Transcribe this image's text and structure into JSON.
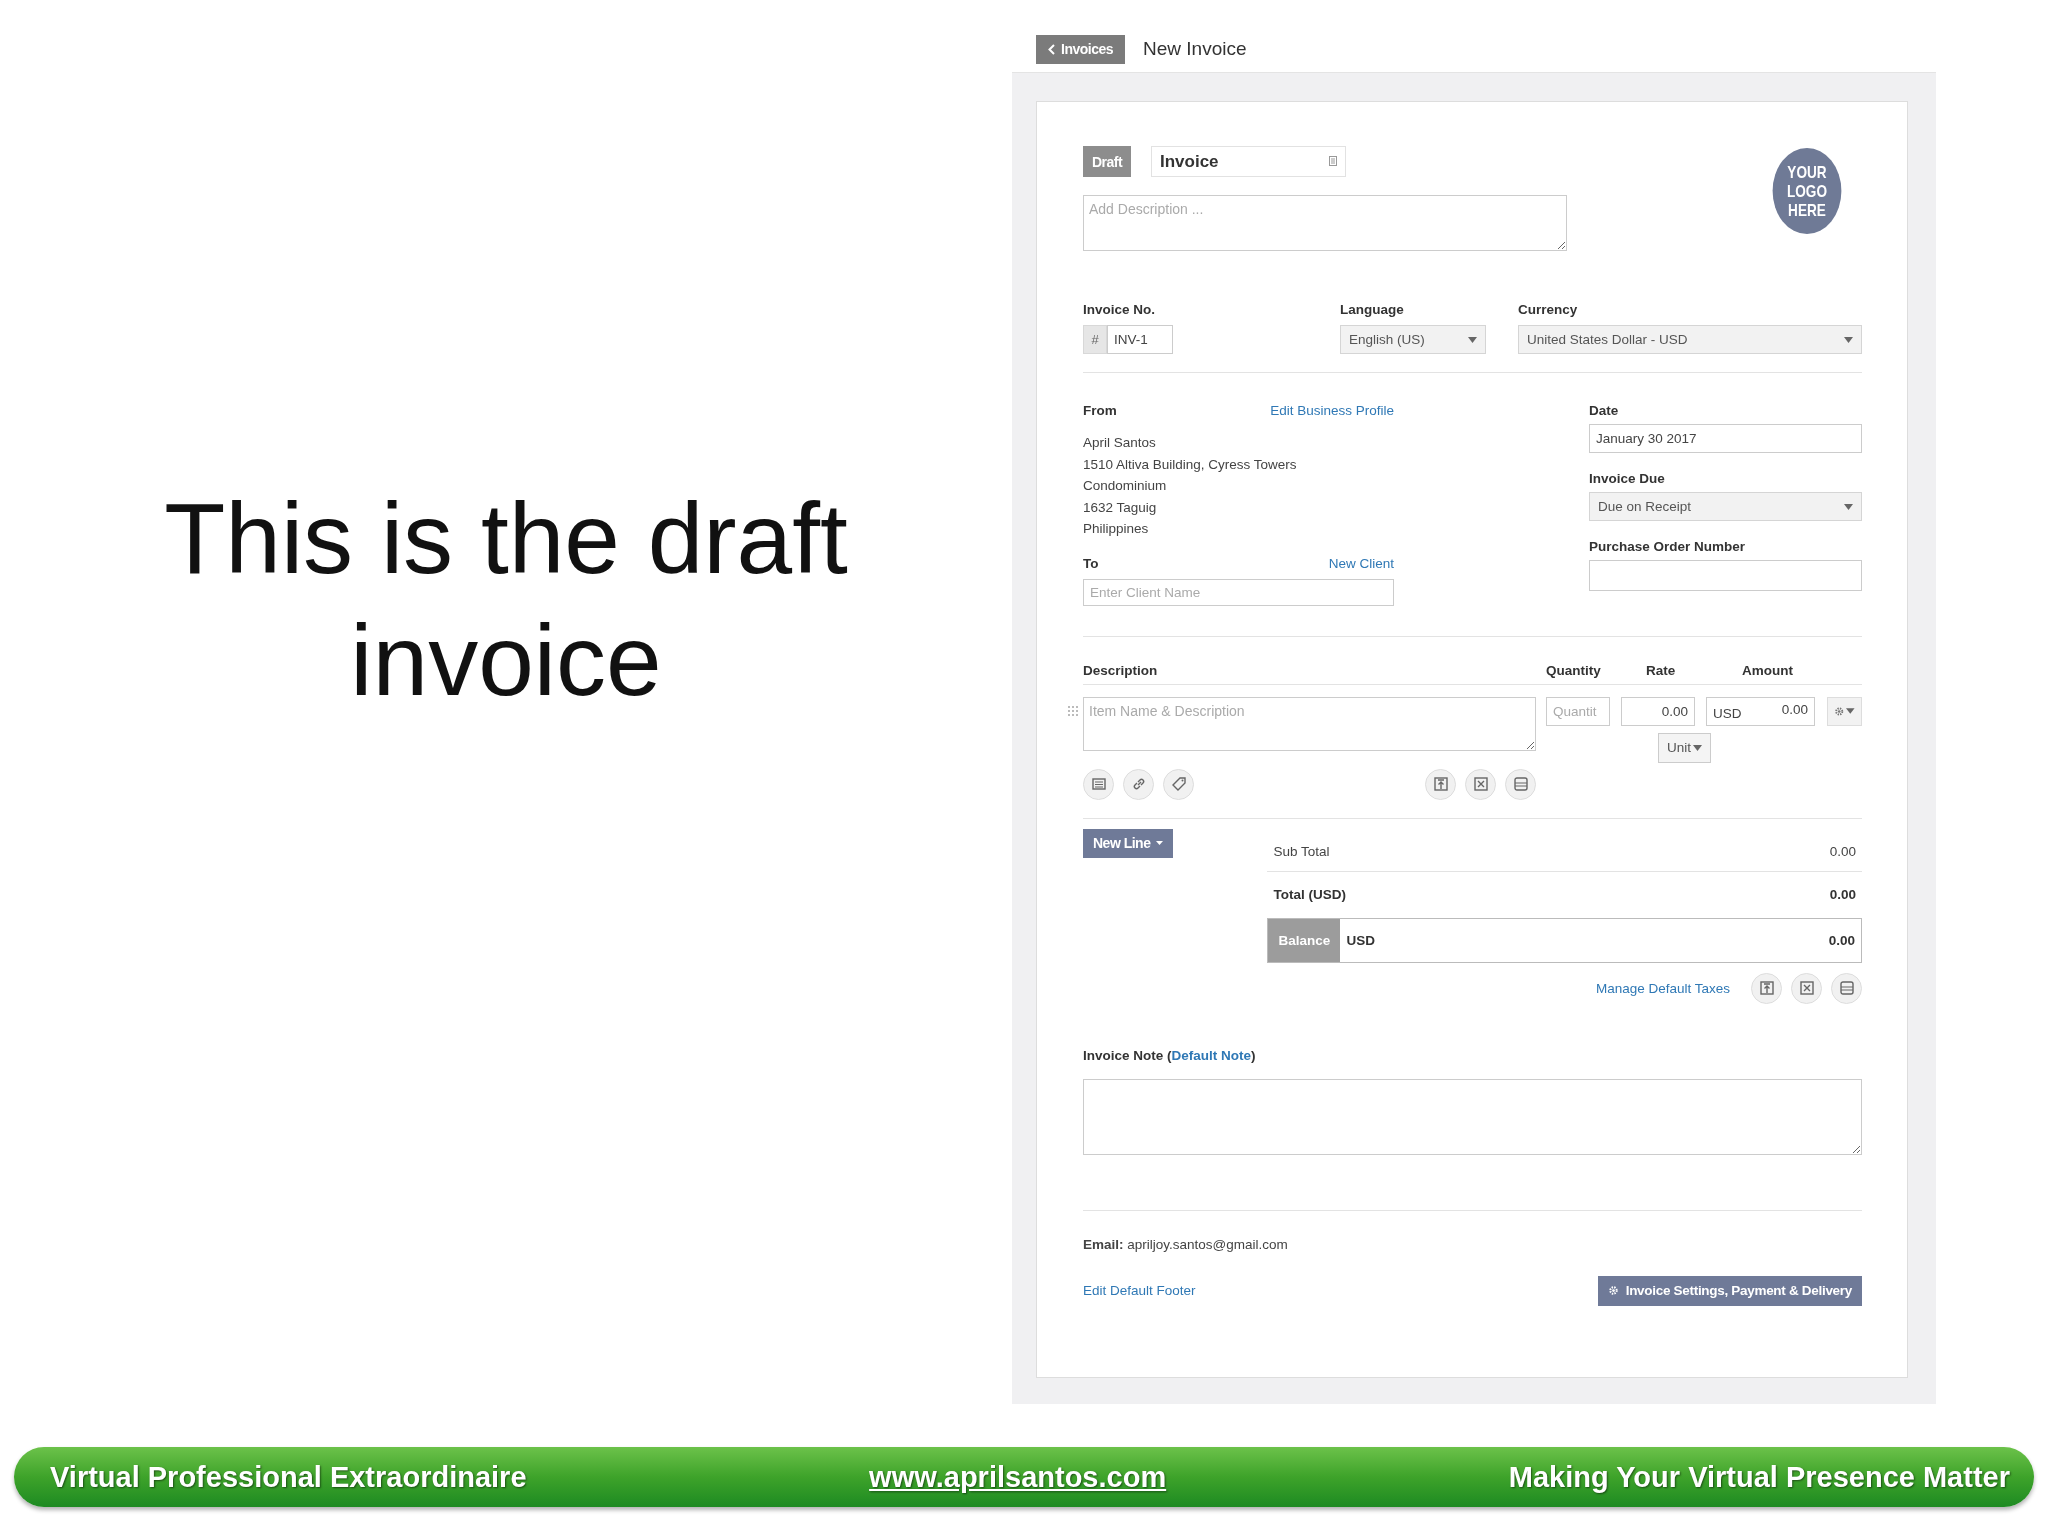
{
  "slide": {
    "caption": "This is the draft invoice"
  },
  "app": {
    "back_button": "Invoices",
    "page_title": "New Invoice",
    "status_badge": "Draft",
    "title_field": {
      "value": "Invoice"
    },
    "description_field": {
      "placeholder": "Add Description ..."
    },
    "logo": {
      "lines": [
        "YOUR",
        "LOGO",
        "HERE"
      ]
    },
    "invoice_no": {
      "label": "Invoice No.",
      "prefix": "#",
      "value": "INV-1"
    },
    "language": {
      "label": "Language",
      "value": "English (US)"
    },
    "currency": {
      "label": "Currency",
      "value": "United States Dollar - USD"
    },
    "from": {
      "label": "From",
      "link": "Edit Business Profile",
      "address": [
        "April Santos",
        "1510 Altiva Building, Cyress Towers",
        "Condominium",
        "1632 Taguig",
        "Philippines"
      ]
    },
    "to": {
      "label": "To",
      "link": "New Client",
      "placeholder": "Enter Client Name"
    },
    "date": {
      "label": "Date",
      "value": "January 30 2017"
    },
    "invoice_due": {
      "label": "Invoice Due",
      "value": "Due on Receipt"
    },
    "purchase_order": {
      "label": "Purchase Order Number"
    },
    "items": {
      "columns": [
        "Description",
        "Quantity",
        "Rate",
        "Amount"
      ],
      "description_placeholder": "Item Name & Description",
      "quantity_placeholder": "Quantit",
      "rate": "0.00",
      "amount_currency": "USD",
      "amount": "0.00",
      "unit_button": "Unit"
    },
    "new_line_button": "New Line",
    "totals": [
      {
        "kind": "plain",
        "label": "Sub Total",
        "value": "0.00"
      },
      {
        "kind": "bold",
        "label": "Total (USD)",
        "value": "0.00"
      },
      {
        "kind": "balance",
        "label": "Balance",
        "currency": "USD",
        "value": "0.00"
      }
    ],
    "manage_taxes_link": "Manage Default Taxes",
    "invoice_note": {
      "label": "Invoice Note (",
      "link": "Default Note",
      "after": ")"
    },
    "email": "**Email:** apriljoy.santos@gmail.com",
    "footer_link": "Edit Default Footer",
    "settings_button": "Invoice Settings, Payment & Delivery"
  },
  "footer": {
    "left": "Virtual Professional Extraordinaire",
    "center": "www.aprilsantos.com",
    "right": "Making Your Virtual Presence Matter"
  }
}
